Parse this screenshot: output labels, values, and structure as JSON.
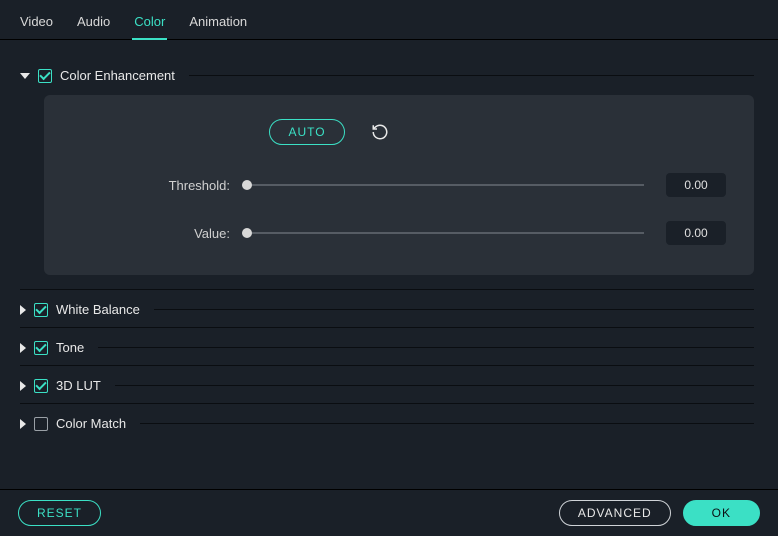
{
  "tabs": {
    "video": "Video",
    "audio": "Audio",
    "color": "Color",
    "animation": "Animation"
  },
  "sections": {
    "color_enhancement": {
      "title": "Color Enhancement"
    },
    "white_balance": {
      "title": "White Balance"
    },
    "tone": {
      "title": "Tone"
    },
    "lut": {
      "title": "3D LUT"
    },
    "color_match": {
      "title": "Color Match"
    }
  },
  "panel": {
    "auto": "AUTO",
    "threshold_label": "Threshold:",
    "threshold_value": "0.00",
    "value_label": "Value:",
    "value_value": "0.00"
  },
  "footer": {
    "reset": "RESET",
    "advanced": "ADVANCED",
    "ok": "OK"
  }
}
